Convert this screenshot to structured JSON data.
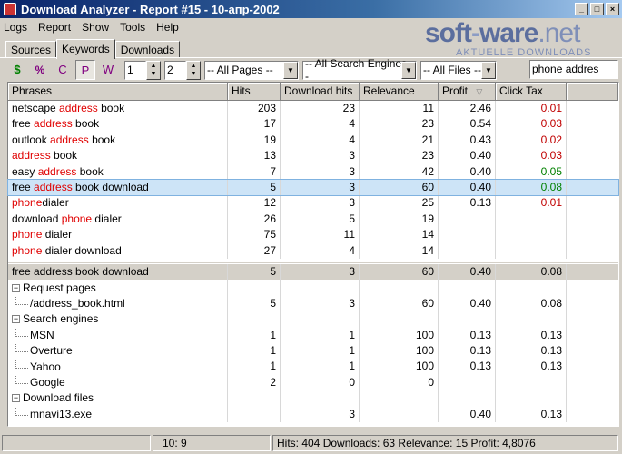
{
  "window": {
    "title": "Download Analyzer  -  Report #15 - 10-апр-2002"
  },
  "menu": [
    "Logs",
    "Report",
    "Show",
    "Tools",
    "Help"
  ],
  "logo": {
    "brand_a": "soft",
    "brand_b": "ware",
    "brand_c": ".net",
    "sub": "AKTUELLE DOWNLOADS"
  },
  "tabs": [
    "Sources",
    "Keywords",
    "Downloads"
  ],
  "toolbar": {
    "icons": [
      "$",
      "%",
      "C",
      "P",
      "W"
    ],
    "spin1": "1",
    "spin2": "2",
    "pages": "-- All Pages --",
    "engines": "-- All Search Engines --",
    "files": "-- All Files --",
    "search": "phone addres"
  },
  "columns": {
    "phrases": "Phrases",
    "hits": "Hits",
    "download_hits": "Download hits",
    "relevance": "Relevance",
    "profit": "Profit",
    "click_tax": "Click Tax"
  },
  "rows": [
    {
      "pre": "netscape ",
      "kw": "address",
      "post": " book",
      "hits": "203",
      "dl": "23",
      "rel": "11",
      "profit": "2.46",
      "tax": "0.01",
      "tc": "red"
    },
    {
      "pre": "free ",
      "kw": "address",
      "post": " book",
      "hits": "17",
      "dl": "4",
      "rel": "23",
      "profit": "0.54",
      "tax": "0.03",
      "tc": "red"
    },
    {
      "pre": "outlook ",
      "kw": "address",
      "post": " book",
      "hits": "19",
      "dl": "4",
      "rel": "21",
      "profit": "0.43",
      "tax": "0.02",
      "tc": "red"
    },
    {
      "pre": "",
      "kw": "address",
      "post": " book",
      "hits": "13",
      "dl": "3",
      "rel": "23",
      "profit": "0.40",
      "tax": "0.03",
      "tc": "red"
    },
    {
      "pre": "easy ",
      "kw": "address",
      "post": " book",
      "hits": "7",
      "dl": "3",
      "rel": "42",
      "profit": "0.40",
      "tax": "0.05",
      "tc": "green"
    },
    {
      "pre": "free ",
      "kw": "address",
      "post": " book download",
      "hits": "5",
      "dl": "3",
      "rel": "60",
      "profit": "0.40",
      "tax": "0.08",
      "tc": "green",
      "sel": true
    },
    {
      "pre": "",
      "kw": "phone",
      "post": "dialer",
      "hits": "12",
      "dl": "3",
      "rel": "25",
      "profit": "0.13",
      "tax": "0.01",
      "tc": "red"
    },
    {
      "pre": "download ",
      "kw": "phone",
      "post": " dialer",
      "hits": "26",
      "dl": "5",
      "rel": "19",
      "profit": "",
      "tax": "",
      "tc": "red"
    },
    {
      "pre": "",
      "kw": "phone",
      "post": " dialer",
      "hits": "75",
      "dl": "11",
      "rel": "14",
      "profit": "",
      "tax": "",
      "tc": "red"
    },
    {
      "pre": "",
      "kw": "phone",
      "post": " dialer download",
      "hits": "27",
      "dl": "4",
      "rel": "14",
      "profit": "",
      "tax": "",
      "tc": "red"
    }
  ],
  "detail": [
    {
      "type": "head",
      "label": "free address book download",
      "hits": "5",
      "dl": "3",
      "rel": "60",
      "profit": "0.40",
      "tax": "0.08"
    },
    {
      "type": "group",
      "label": "Request pages",
      "hits": "",
      "dl": "",
      "rel": "",
      "profit": "",
      "tax": ""
    },
    {
      "type": "leaf",
      "label": "/address_book.html",
      "hits": "5",
      "dl": "3",
      "rel": "60",
      "profit": "0.40",
      "tax": "0.08"
    },
    {
      "type": "group",
      "label": "Search engines",
      "hits": "",
      "dl": "",
      "rel": "",
      "profit": "",
      "tax": ""
    },
    {
      "type": "leaf",
      "label": "MSN",
      "hits": "1",
      "dl": "1",
      "rel": "100",
      "profit": "0.13",
      "tax": "0.13"
    },
    {
      "type": "leaf",
      "label": "Overture",
      "hits": "1",
      "dl": "1",
      "rel": "100",
      "profit": "0.13",
      "tax": "0.13"
    },
    {
      "type": "leaf",
      "label": "Yahoo",
      "hits": "1",
      "dl": "1",
      "rel": "100",
      "profit": "0.13",
      "tax": "0.13"
    },
    {
      "type": "leaf",
      "label": "Google",
      "hits": "2",
      "dl": "0",
      "rel": "0",
      "profit": "",
      "tax": ""
    },
    {
      "type": "group",
      "label": "Download files",
      "hits": "",
      "dl": "",
      "rel": "",
      "profit": "",
      "tax": ""
    },
    {
      "type": "leaf",
      "label": "mnavi13.exe",
      "hits": "",
      "dl": "3",
      "rel": "",
      "profit": "0.40",
      "tax": "0.13"
    }
  ],
  "status": {
    "pos": "10:   9",
    "summary": "Hits: 404  Downloads: 63  Relevance: 15  Profit: 4,8076"
  }
}
